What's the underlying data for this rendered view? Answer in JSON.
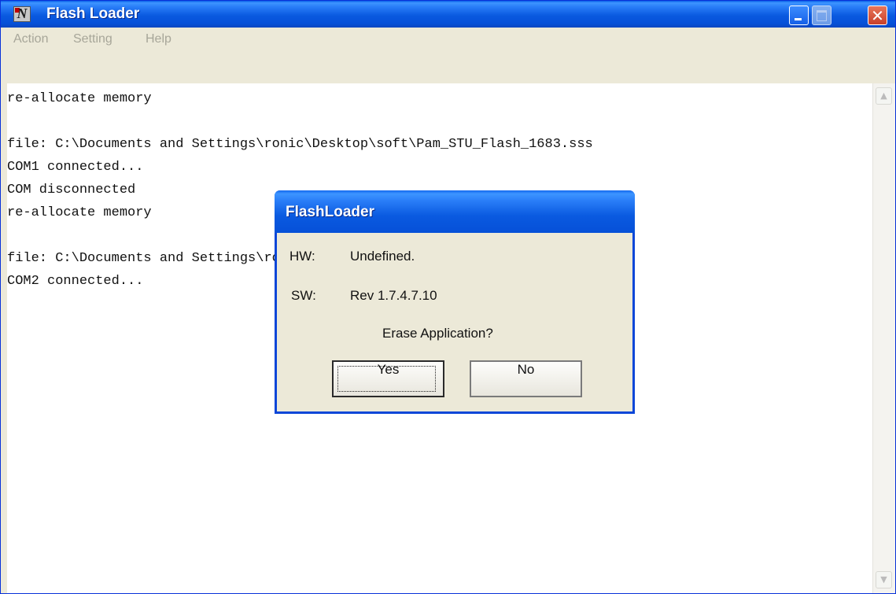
{
  "window": {
    "title": "Flash Loader",
    "app_icon": "flashloader-app-icon",
    "controls": [
      "minimize-icon",
      "maximize-icon",
      "close-icon"
    ],
    "close_glyph": "✕"
  },
  "menu": {
    "items": [
      "Action",
      "Setting",
      "Help"
    ]
  },
  "log": {
    "lines": [
      "re-allocate memory",
      "",
      "file: C:\\Documents and Settings\\ronic\\Desktop\\soft\\Pam_STU_Flash_1683.sss",
      "COM1 connected...",
      "COM disconnected",
      "re-allocate memory",
      "",
      "file: C:\\Documents and Settings\\ronic\\Desktop\\soft\\Pam_STU_Flash_1683.sss",
      "COM2 connected..."
    ]
  },
  "scrollbar": {
    "up_glyph": "▲",
    "down_glyph": "▼"
  },
  "dialog": {
    "title": "FlashLoader",
    "hw_label": "HW:",
    "hw_value": "Undefined.",
    "sw_label": "SW:",
    "sw_value": "Rev 1.7.4.7.10",
    "question": "Erase Application?",
    "yes_label": "Yes",
    "no_label": "No"
  },
  "colors": {
    "titlebar": "#0a5ae0",
    "window_bg": "#ece9d8",
    "disabled_menu_text": "#a7a699"
  }
}
